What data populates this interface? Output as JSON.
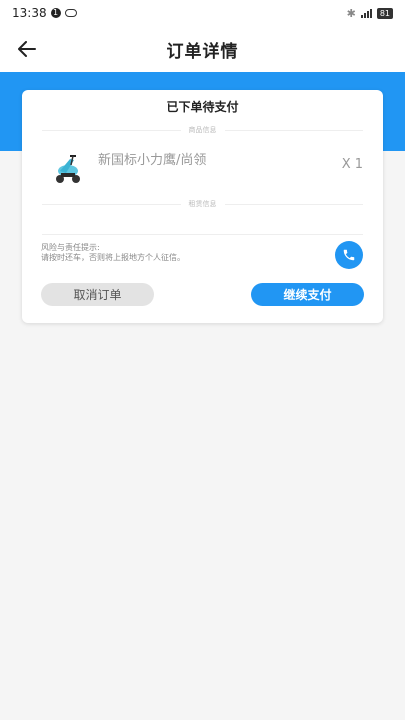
{
  "status_bar": {
    "time": "13:38",
    "notification_count": "1",
    "battery": "81"
  },
  "nav": {
    "title": "订单详情"
  },
  "order": {
    "status_title": "已下单待支付",
    "goods_section_label": "商品信息",
    "product_name": "新国标小力鹰/尚领",
    "quantity": "X 1",
    "rental_section_label": "租赁信息",
    "risk_title": "风险与责任提示:",
    "risk_body": "请按时还车，否则将上报地方个人征信。"
  },
  "actions": {
    "cancel_label": "取消订单",
    "pay_label": "继续支付"
  },
  "colors": {
    "accent": "#2196f3",
    "cancel_bg": "#e3e3e3",
    "page_bg": "#f5f5f5"
  },
  "icons": {
    "back": "arrow-left-icon",
    "phone": "phone-icon",
    "product": "scooter-icon"
  }
}
